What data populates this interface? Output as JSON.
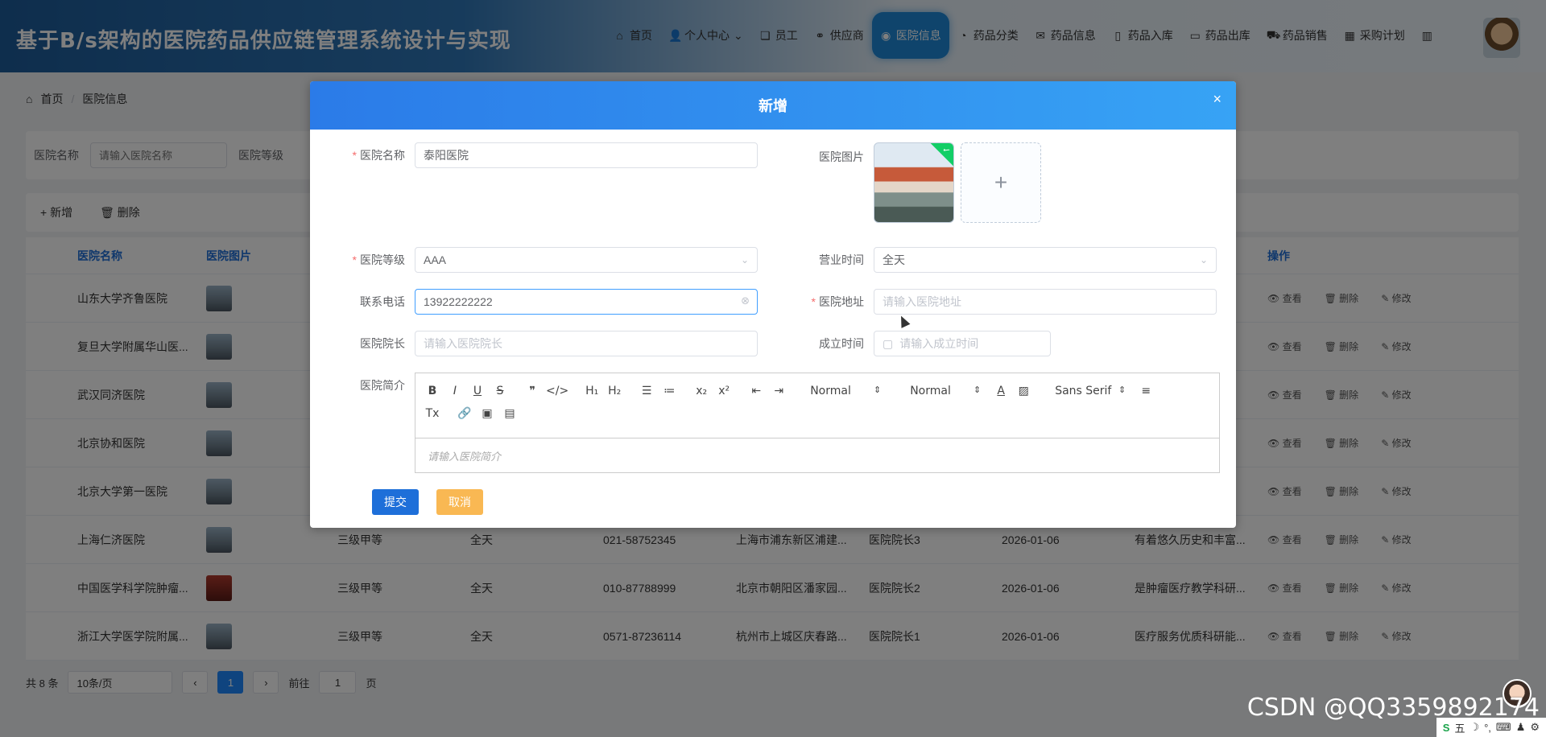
{
  "header": {
    "title": "基于B/s架构的医院药品供应链管理系统设计与实现",
    "nav": [
      {
        "label": "首页",
        "icon": "home-icon",
        "glyph": "⌂"
      },
      {
        "label": "个人中心",
        "icon": "user-icon",
        "glyph": "👤",
        "suffix": "⌄"
      },
      {
        "label": "员工",
        "icon": "staff-icon",
        "glyph": "❏"
      },
      {
        "label": "供应商",
        "icon": "supplier-icon",
        "glyph": "⚭"
      },
      {
        "label": "医院信息",
        "icon": "hospital-icon",
        "glyph": "◉",
        "active": true
      },
      {
        "label": "药品分类",
        "icon": "category-icon",
        "glyph": "◔"
      },
      {
        "label": "药品信息",
        "icon": "mail-icon",
        "glyph": "✉"
      },
      {
        "label": "药品入库",
        "icon": "inbound-icon",
        "glyph": "▯"
      },
      {
        "label": "药品出库",
        "icon": "outbound-icon",
        "glyph": "▭"
      },
      {
        "label": "药品销售",
        "icon": "cart-icon",
        "glyph": "⛟"
      },
      {
        "label": "采购计划",
        "icon": "plan-icon",
        "glyph": "▦"
      },
      {
        "label": "",
        "icon": "building-icon",
        "glyph": "▥"
      }
    ]
  },
  "breadcrumb": {
    "home": "首页",
    "sep": "/",
    "current": "医院信息"
  },
  "search": {
    "name_label": "医院名称",
    "name_placeholder": "请输入医院名称",
    "level_label": "医院等级"
  },
  "toolbar": {
    "add": "新增",
    "delete": "删除"
  },
  "table": {
    "headers": [
      "医院名称",
      "医院图片",
      "",
      "",
      "",
      "",
      "",
      "",
      "",
      "操作"
    ],
    "rows": [
      {
        "name": "山东大学齐鲁医院",
        "level": "",
        "hours": "",
        "phone": "",
        "address": "",
        "dean": "",
        "date": "",
        "intro": "",
        "thumb": "gray"
      },
      {
        "name": "复旦大学附属华山医...",
        "level": "",
        "hours": "",
        "phone": "",
        "address": "",
        "dean": "",
        "date": "",
        "intro": "",
        "thumb": "gray"
      },
      {
        "name": "武汉同济医院",
        "level": "",
        "hours": "",
        "phone": "",
        "address": "",
        "dean": "",
        "date": "",
        "intro": "",
        "thumb": "gray"
      },
      {
        "name": "北京协和医院",
        "level": "",
        "hours": "",
        "phone": "",
        "address": "",
        "dean": "",
        "date": "",
        "intro": "",
        "thumb": "gray"
      },
      {
        "name": "北京大学第一医院",
        "level": "",
        "hours": "",
        "phone": "",
        "address": "",
        "dean": "",
        "date": "",
        "intro": "",
        "thumb": "gray"
      },
      {
        "name": "上海仁济医院",
        "level": "三级甲等",
        "hours": "全天",
        "phone": "021-58752345",
        "address": "上海市浦东新区浦建...",
        "dean": "医院院长3",
        "date": "2026-01-06",
        "intro": "有着悠久历史和丰富...",
        "thumb": "gray"
      },
      {
        "name": "中国医学科学院肿瘤...",
        "level": "三级甲等",
        "hours": "全天",
        "phone": "010-87788999",
        "address": "北京市朝阳区潘家园...",
        "dean": "医院院长2",
        "date": "2026-01-06",
        "intro": "是肿瘤医疗教学科研...",
        "thumb": "red"
      },
      {
        "name": "浙江大学医学院附属...",
        "level": "三级甲等",
        "hours": "全天",
        "phone": "0571-87236114",
        "address": "杭州市上城区庆春路...",
        "dean": "医院院长1",
        "date": "2026-01-06",
        "intro": "医疗服务优质科研能...",
        "thumb": "gray"
      }
    ],
    "ops": {
      "view": "查看",
      "delete": "删除",
      "edit": "修改"
    }
  },
  "pager": {
    "total": "共 8 条",
    "size": "10条/页",
    "page": "1",
    "goto": "前往",
    "goto_value": "1",
    "unit": "页"
  },
  "dialog": {
    "title": "新增",
    "close": "×",
    "fields": {
      "name": {
        "label": "医院名称",
        "value": "泰阳医院",
        "required": true
      },
      "pic": {
        "label": "医院图片"
      },
      "level": {
        "label": "医院等级",
        "value": "AAA",
        "required": true
      },
      "hours": {
        "label": "营业时间",
        "value": "全天"
      },
      "phone": {
        "label": "联系电话",
        "value": "13922222222"
      },
      "address": {
        "label": "医院地址",
        "placeholder": "请输入医院地址",
        "required": true
      },
      "dean": {
        "label": "医院院长",
        "placeholder": "请输入医院院长"
      },
      "date": {
        "label": "成立时间",
        "placeholder": "请输入成立时间"
      },
      "intro": {
        "label": "医院简介",
        "placeholder": "请输入医院简介"
      }
    },
    "editor": {
      "row1": [
        "B",
        "I",
        "U",
        "S",
        "❞",
        "</>",
        "H₁",
        "H₂",
        "☰",
        "≔",
        "x₂",
        "x²",
        "⇤",
        "⇥"
      ],
      "select1": "Normal",
      "select2": "Normal",
      "color": "A",
      "bg": "▨",
      "font": "Sans Serif",
      "align": "≡",
      "row2": [
        "Tx",
        "🔗",
        "▣",
        "▤"
      ]
    },
    "submit": "提交",
    "cancel": "取消"
  },
  "watermark": "CSDN @QQ3359892174",
  "taskbar": {
    "items": [
      "S",
      "五",
      "☽",
      "°,",
      "⌨",
      "♟",
      "⚙"
    ]
  }
}
